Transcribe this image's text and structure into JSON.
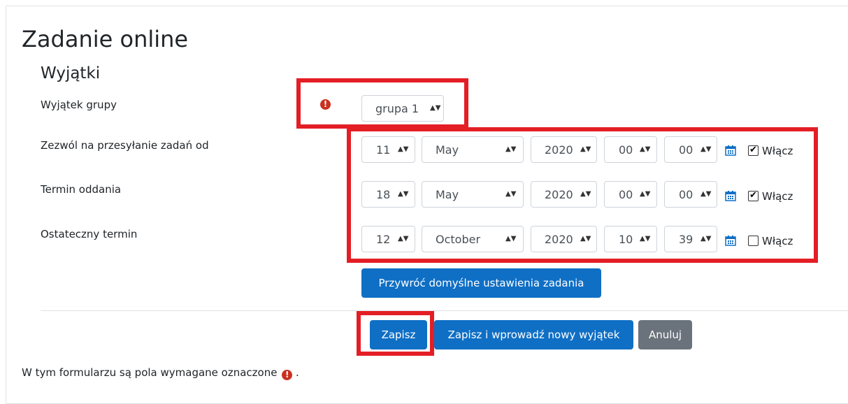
{
  "page": {
    "title": "Zadanie online",
    "section": "Wyjątki",
    "required_note_prefix": "W tym formularzu są pola wymagane oznaczone",
    "required_note_suffix": "."
  },
  "form": {
    "group": {
      "label": "Wyjątek grupy",
      "value": "grupa 1"
    },
    "rows": [
      {
        "label": "Zezwól na przesyłanie zadań od",
        "day": "11",
        "month": "May",
        "year": "2020",
        "hour": "00",
        "minute": "00",
        "enabled": true,
        "enable_label": "Włącz"
      },
      {
        "label": "Termin oddania",
        "day": "18",
        "month": "May",
        "year": "2020",
        "hour": "00",
        "minute": "00",
        "enabled": true,
        "enable_label": "Włącz"
      },
      {
        "label": "Ostateczny termin",
        "day": "12",
        "month": "October",
        "year": "2020",
        "hour": "10",
        "minute": "39",
        "enabled": false,
        "enable_label": "Włącz"
      }
    ],
    "reset_button": "Przywróć domyślne ustawienia zadania"
  },
  "actions": {
    "save": "Zapisz",
    "save_new": "Zapisz i wprowadź nowy wyjątek",
    "cancel": "Anuluj"
  },
  "colors": {
    "primary": "#0f6fc5",
    "secondary": "#6a737b",
    "required": "#ca3120",
    "highlight": "#e41e25"
  },
  "icons": {
    "required": "exclamation-circle-icon",
    "calendar": "calendar-icon",
    "select_arrows": "sort-arrows-icon"
  }
}
